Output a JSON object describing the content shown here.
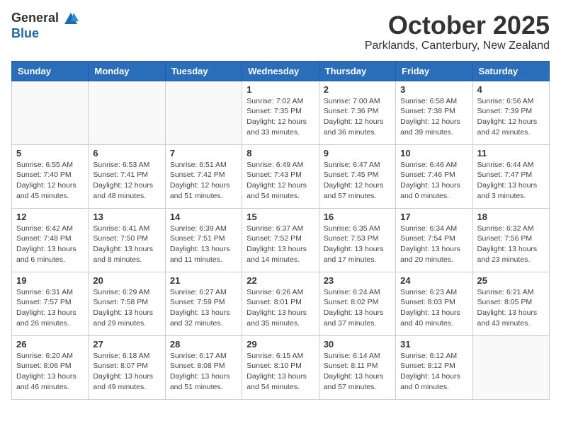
{
  "header": {
    "logo_general": "General",
    "logo_blue": "Blue",
    "month": "October 2025",
    "location": "Parklands, Canterbury, New Zealand"
  },
  "days_of_week": [
    "Sunday",
    "Monday",
    "Tuesday",
    "Wednesday",
    "Thursday",
    "Friday",
    "Saturday"
  ],
  "weeks": [
    [
      {
        "day": "",
        "info": ""
      },
      {
        "day": "",
        "info": ""
      },
      {
        "day": "",
        "info": ""
      },
      {
        "day": "1",
        "info": "Sunrise: 7:02 AM\nSunset: 7:35 PM\nDaylight: 12 hours\nand 33 minutes."
      },
      {
        "day": "2",
        "info": "Sunrise: 7:00 AM\nSunset: 7:36 PM\nDaylight: 12 hours\nand 36 minutes."
      },
      {
        "day": "3",
        "info": "Sunrise: 6:58 AM\nSunset: 7:38 PM\nDaylight: 12 hours\nand 39 minutes."
      },
      {
        "day": "4",
        "info": "Sunrise: 6:56 AM\nSunset: 7:39 PM\nDaylight: 12 hours\nand 42 minutes."
      }
    ],
    [
      {
        "day": "5",
        "info": "Sunrise: 6:55 AM\nSunset: 7:40 PM\nDaylight: 12 hours\nand 45 minutes."
      },
      {
        "day": "6",
        "info": "Sunrise: 6:53 AM\nSunset: 7:41 PM\nDaylight: 12 hours\nand 48 minutes."
      },
      {
        "day": "7",
        "info": "Sunrise: 6:51 AM\nSunset: 7:42 PM\nDaylight: 12 hours\nand 51 minutes."
      },
      {
        "day": "8",
        "info": "Sunrise: 6:49 AM\nSunset: 7:43 PM\nDaylight: 12 hours\nand 54 minutes."
      },
      {
        "day": "9",
        "info": "Sunrise: 6:47 AM\nSunset: 7:45 PM\nDaylight: 12 hours\nand 57 minutes."
      },
      {
        "day": "10",
        "info": "Sunrise: 6:46 AM\nSunset: 7:46 PM\nDaylight: 13 hours\nand 0 minutes."
      },
      {
        "day": "11",
        "info": "Sunrise: 6:44 AM\nSunset: 7:47 PM\nDaylight: 13 hours\nand 3 minutes."
      }
    ],
    [
      {
        "day": "12",
        "info": "Sunrise: 6:42 AM\nSunset: 7:48 PM\nDaylight: 13 hours\nand 6 minutes."
      },
      {
        "day": "13",
        "info": "Sunrise: 6:41 AM\nSunset: 7:50 PM\nDaylight: 13 hours\nand 8 minutes."
      },
      {
        "day": "14",
        "info": "Sunrise: 6:39 AM\nSunset: 7:51 PM\nDaylight: 13 hours\nand 11 minutes."
      },
      {
        "day": "15",
        "info": "Sunrise: 6:37 AM\nSunset: 7:52 PM\nDaylight: 13 hours\nand 14 minutes."
      },
      {
        "day": "16",
        "info": "Sunrise: 6:35 AM\nSunset: 7:53 PM\nDaylight: 13 hours\nand 17 minutes."
      },
      {
        "day": "17",
        "info": "Sunrise: 6:34 AM\nSunset: 7:54 PM\nDaylight: 13 hours\nand 20 minutes."
      },
      {
        "day": "18",
        "info": "Sunrise: 6:32 AM\nSunset: 7:56 PM\nDaylight: 13 hours\nand 23 minutes."
      }
    ],
    [
      {
        "day": "19",
        "info": "Sunrise: 6:31 AM\nSunset: 7:57 PM\nDaylight: 13 hours\nand 26 minutes."
      },
      {
        "day": "20",
        "info": "Sunrise: 6:29 AM\nSunset: 7:58 PM\nDaylight: 13 hours\nand 29 minutes."
      },
      {
        "day": "21",
        "info": "Sunrise: 6:27 AM\nSunset: 7:59 PM\nDaylight: 13 hours\nand 32 minutes."
      },
      {
        "day": "22",
        "info": "Sunrise: 6:26 AM\nSunset: 8:01 PM\nDaylight: 13 hours\nand 35 minutes."
      },
      {
        "day": "23",
        "info": "Sunrise: 6:24 AM\nSunset: 8:02 PM\nDaylight: 13 hours\nand 37 minutes."
      },
      {
        "day": "24",
        "info": "Sunrise: 6:23 AM\nSunset: 8:03 PM\nDaylight: 13 hours\nand 40 minutes."
      },
      {
        "day": "25",
        "info": "Sunrise: 6:21 AM\nSunset: 8:05 PM\nDaylight: 13 hours\nand 43 minutes."
      }
    ],
    [
      {
        "day": "26",
        "info": "Sunrise: 6:20 AM\nSunset: 8:06 PM\nDaylight: 13 hours\nand 46 minutes."
      },
      {
        "day": "27",
        "info": "Sunrise: 6:18 AM\nSunset: 8:07 PM\nDaylight: 13 hours\nand 49 minutes."
      },
      {
        "day": "28",
        "info": "Sunrise: 6:17 AM\nSunset: 8:08 PM\nDaylight: 13 hours\nand 51 minutes."
      },
      {
        "day": "29",
        "info": "Sunrise: 6:15 AM\nSunset: 8:10 PM\nDaylight: 13 hours\nand 54 minutes."
      },
      {
        "day": "30",
        "info": "Sunrise: 6:14 AM\nSunset: 8:11 PM\nDaylight: 13 hours\nand 57 minutes."
      },
      {
        "day": "31",
        "info": "Sunrise: 6:12 AM\nSunset: 8:12 PM\nDaylight: 14 hours\nand 0 minutes."
      },
      {
        "day": "",
        "info": ""
      }
    ]
  ]
}
